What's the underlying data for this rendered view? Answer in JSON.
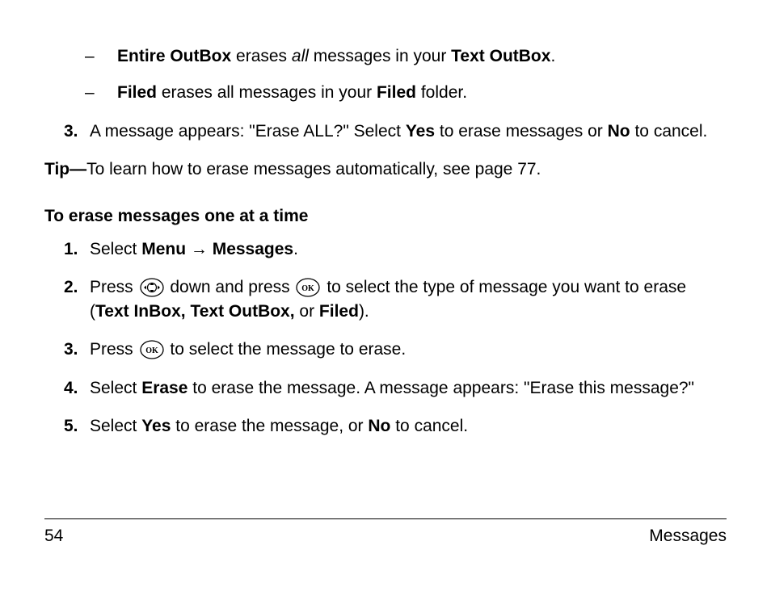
{
  "sub_items": [
    {
      "pre": "Entire OutBox",
      "mid1": " erases ",
      "italic": "all",
      "mid2": " messages in your ",
      "bold2": "Text OutBox",
      "tail": "."
    },
    {
      "pre": "Filed",
      "mid1": " erases all messages in your ",
      "bold2": "Filed",
      "tail": " folder."
    }
  ],
  "top_step3": {
    "num": "3.",
    "t1": "A message appears: \"Erase ALL?\" Select ",
    "b1": "Yes",
    "t2": " to erase messages or ",
    "b2": "No",
    "t3": " to cancel."
  },
  "tip": {
    "label": "Tip—",
    "text": "To learn how to erase messages automatically, see page 77."
  },
  "section_heading": "To erase messages one at a time",
  "steps": {
    "s1": {
      "num": "1.",
      "t1": "Select ",
      "b1": "Menu",
      "arrow": " → ",
      "b2": "Messages",
      "t2": "."
    },
    "s2": {
      "num": "2.",
      "t1": "Press ",
      "t2": " down and press ",
      "t3": " to select the type of message you want to erase (",
      "b1": "Text InBox, Text OutBox,",
      "t4": " or ",
      "b2": "Filed",
      "t5": ")."
    },
    "s3": {
      "num": "3.",
      "t1": "Press ",
      "t2": " to select the message to erase."
    },
    "s4": {
      "num": "4.",
      "t1": "Select ",
      "b1": "Erase",
      "t2": " to erase the message. A message appears: \"Erase this message?\""
    },
    "s5": {
      "num": "5.",
      "t1": "Select ",
      "b1": "Yes",
      "t2": " to erase the message, or ",
      "b2": "No",
      "t3": " to cancel."
    }
  },
  "footer": {
    "page": "54",
    "title": "Messages"
  }
}
